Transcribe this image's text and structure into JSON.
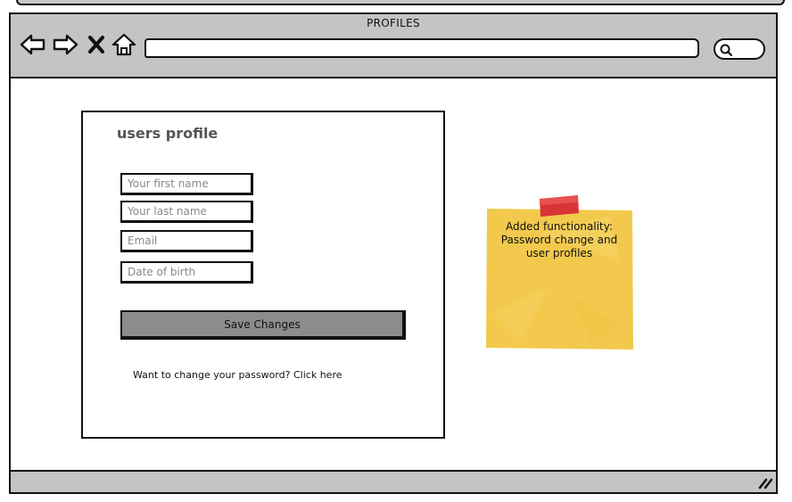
{
  "window": {
    "title": "PROFILES",
    "address_value": ""
  },
  "nav": {
    "icons": [
      "back-arrow-icon",
      "forward-arrow-icon",
      "close-icon",
      "home-icon"
    ]
  },
  "form": {
    "title": "users profile",
    "fields": [
      {
        "placeholder": "Your first name",
        "value": ""
      },
      {
        "placeholder": "Your last name",
        "value": ""
      },
      {
        "placeholder": "Email",
        "value": ""
      },
      {
        "placeholder": "Date of birth",
        "value": ""
      }
    ],
    "save_label": "Save Changes",
    "password_link": "Want to change your password? Click here"
  },
  "sticky_note": {
    "line1": "Added functionality:",
    "line2": "Password change and",
    "line3": "user profiles",
    "note_color": "#f2c94c",
    "tape_color": "#d93434"
  },
  "colors": {
    "chrome": "#c4c4c4",
    "button": "#8c8c8c",
    "outline": "#111111"
  }
}
